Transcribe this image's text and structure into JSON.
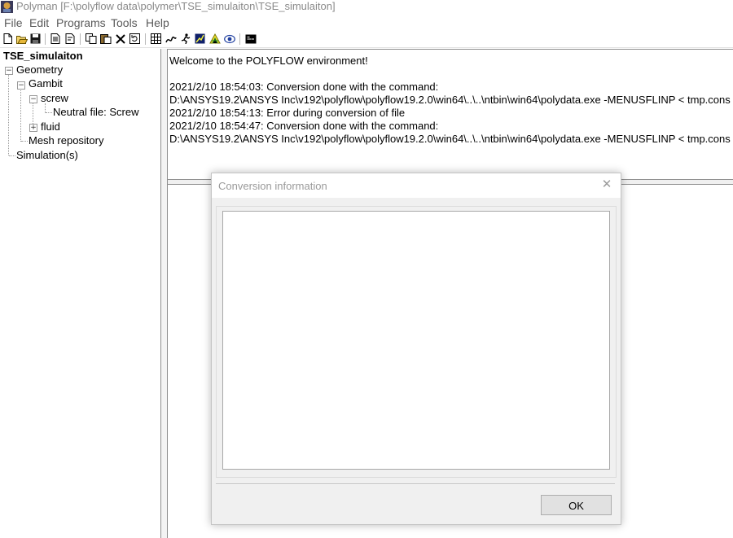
{
  "window": {
    "title": "Polyman [F:\\polyflow data\\polymer\\TSE_simulaiton\\TSE_simulaiton]",
    "app_icon": "polyman-app-icon"
  },
  "menu": [
    "File",
    "Edit",
    "Programs",
    "Tools",
    "Help"
  ],
  "toolbar": [
    "new-icon",
    "open-icon",
    "save-icon",
    "page-icon",
    "page2-icon",
    "copy-icon",
    "paste-icon",
    "delete-icon",
    "refresh-icon",
    "grid-icon",
    "curve-icon",
    "run-icon",
    "chart-icon",
    "mesh-icon",
    "eye-icon",
    "console-icon"
  ],
  "tree": {
    "root": "TSE_simulaiton",
    "geometry": "Geometry",
    "gambit": "Gambit",
    "screw": "screw",
    "neutral": "Neutral file: Screw",
    "fluid": "fluid",
    "mesh": "Mesh repository",
    "simulations": "Simulation(s)"
  },
  "output": {
    "lines": [
      "Welcome to the POLYFLOW environment!",
      "",
      "2021/2/10 18:54:03: Conversion done with the command:",
      "D:\\ANSYS19.2\\ANSYS Inc\\v192\\polyflow\\polyflow19.2.0\\win64\\..\\..\\ntbin\\win64\\polydata.exe -MENUSFLINP < tmp.cons",
      "2021/2/10 18:54:13: Error during conversion of file",
      "2021/2/10 18:54:47: Conversion done with the command:",
      "D:\\ANSYS19.2\\ANSYS Inc\\v192\\polyflow\\polyflow19.2.0\\win64\\..\\..\\ntbin\\win64\\polydata.exe -MENUSFLINP < tmp.cons"
    ]
  },
  "dialog": {
    "title": "Conversion information",
    "close": "✕",
    "ok": "OK"
  },
  "colors": {
    "title_text": "#8a8a8a",
    "menu_text": "#5a5a5a",
    "dialog_bg": "#f0f0f0"
  }
}
